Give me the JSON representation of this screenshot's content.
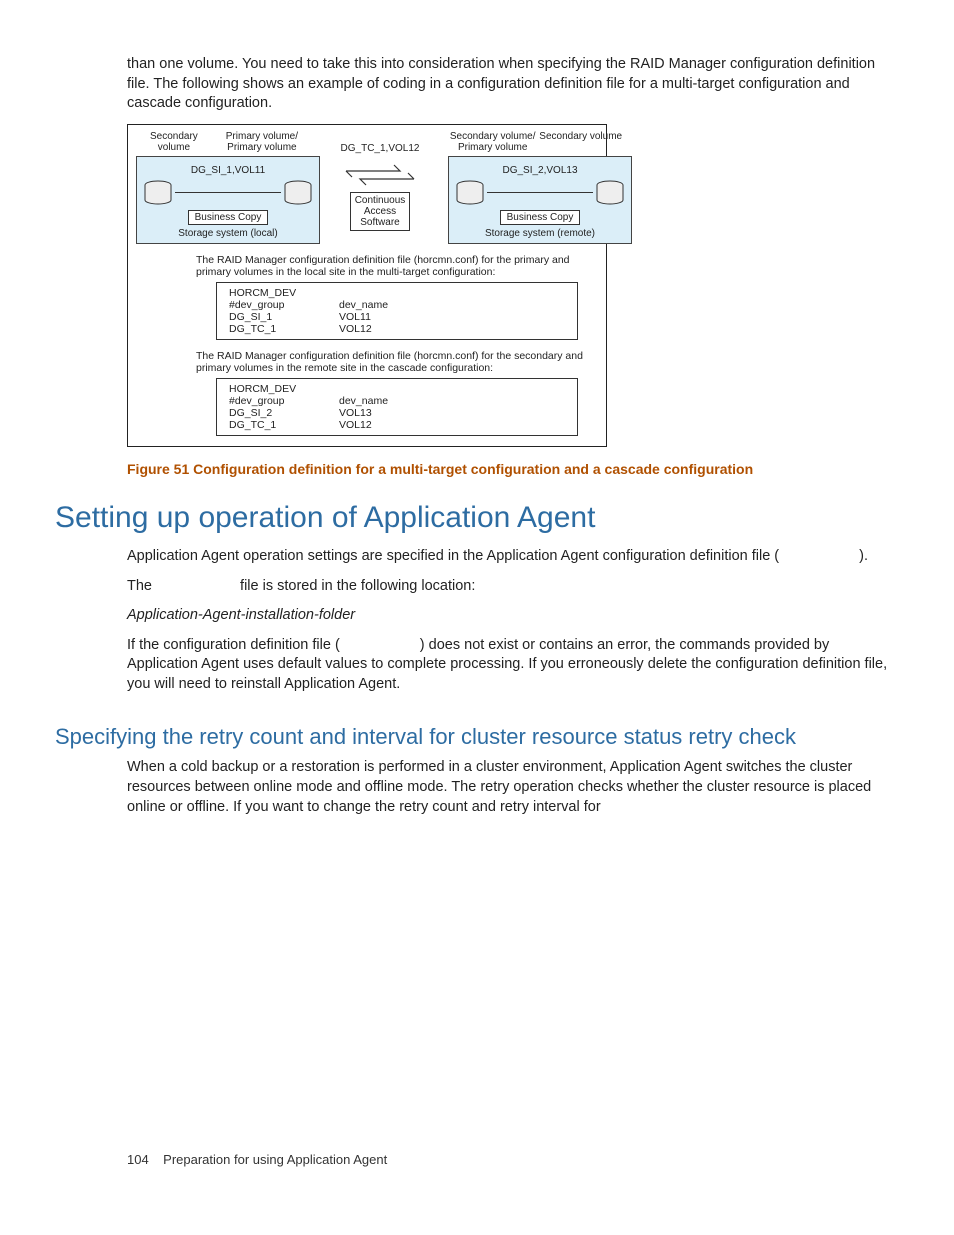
{
  "intro_para": "than one volume. You need to take this into consideration when specifying the RAID Manager configuration definition file. The following shows an example of coding in a configuration definition file for a multi-target configuration and cascade configuration.",
  "diagram": {
    "local": {
      "sec_label": "Secondary\nvolume",
      "prim_label": "Primary volume/\nPrimary volume",
      "vol": "DG_SI_1,VOL11",
      "bc": "Business Copy",
      "storage": "Storage system (local)"
    },
    "mid": {
      "vol": "DG_TC_1,VOL12",
      "cas": "Continuous\nAccess\nSoftware"
    },
    "remote": {
      "prim_label": "Secondary volume/\nPrimary volume",
      "sec_label": "Secondary volume",
      "vol": "DG_SI_2,VOL13",
      "bc": "Business Copy",
      "storage": "Storage system (remote)"
    },
    "conf1_desc": "The RAID Manager configuration definition file (horcmn.conf) for the primary and primary volumes in the local site in the multi-target configuration:",
    "conf1": {
      "l1": "HORCM_DEV",
      "h1": "#dev_group",
      "h2": "dev_name",
      "r1c1": "DG_SI_1",
      "r1c2": "VOL11",
      "r2c1": "DG_TC_1",
      "r2c2": "VOL12"
    },
    "conf2_desc": "The RAID Manager configuration definition file (horcmn.conf) for the secondary and primary volumes in the remote site in the cascade configuration:",
    "conf2": {
      "l1": "HORCM_DEV",
      "h1": "#dev_group",
      "h2": "dev_name",
      "r1c1": "DG_SI_2",
      "r1c2": "VOL13",
      "r2c1": "DG_TC_1",
      "r2c2": "VOL12"
    }
  },
  "figure_caption": "Figure 51 Configuration definition for a multi-target configuration and a cascade configuration",
  "h1": "Setting up operation of Application Agent",
  "p1a": "Application Agent operation settings are specified in the Application Agent configuration definition file (",
  "p1b": ").",
  "p2a": "The ",
  "p2b": " file is stored in the following location:",
  "path": "Application-Agent-installation-folder",
  "p3a": "If the configuration definition file (",
  "p3b": ") does not exist or contains an error, the commands provided by Application Agent uses default values to complete processing. If you erroneously delete the configuration definition file, you will need to reinstall Application Agent.",
  "h2": "Specifying the retry count and interval for cluster resource status retry check",
  "p4": "When a cold backup or a restoration is performed in a cluster environment, Application Agent switches the cluster resources between online mode and offline mode. The retry operation checks whether the cluster resource is placed online or offline. If you want to change the retry count and retry interval for",
  "footer_page": "104",
  "footer_text": "Preparation for using Application Agent"
}
